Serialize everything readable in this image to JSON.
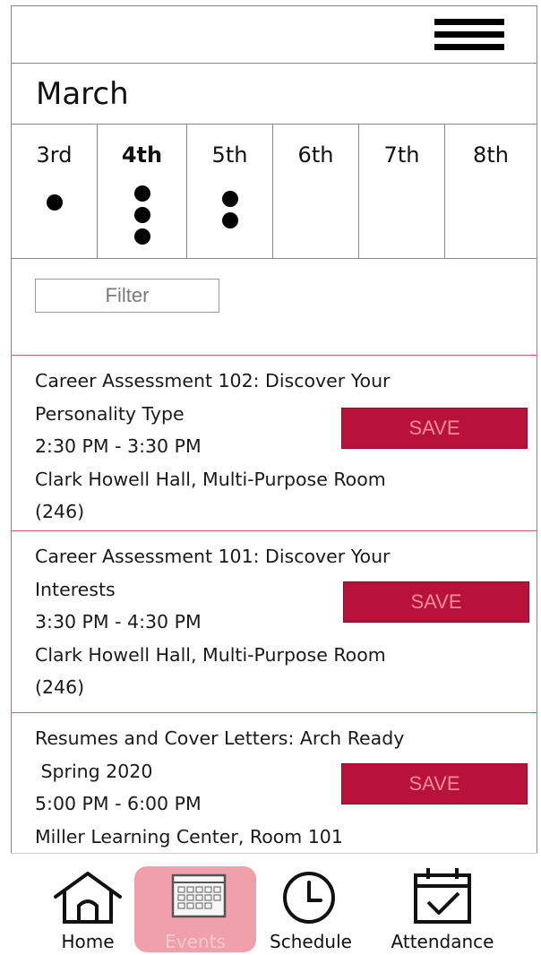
{
  "header": {
    "menu_icon": "hamburger-menu-icon"
  },
  "calendar": {
    "month": "March",
    "days": [
      {
        "label": "3rd",
        "dots": 1,
        "active": false
      },
      {
        "label": "4th",
        "dots": 3,
        "active": true
      },
      {
        "label": "5th",
        "dots": 2,
        "active": false
      },
      {
        "label": "6th",
        "dots": 0,
        "active": false
      },
      {
        "label": "7th",
        "dots": 0,
        "active": false
      },
      {
        "label": "8th",
        "dots": 0,
        "active": false
      }
    ]
  },
  "filter": {
    "placeholder": "Filter",
    "value": ""
  },
  "events": [
    {
      "lines": [
        "Career Assessment 102: Discover Your",
        "Personality Type",
        "2:30 PM - 3:30 PM",
        "Clark Howell Hall, Multi-Purpose Room",
        "(246)"
      ],
      "save_label": "SAVE"
    },
    {
      "lines": [
        "Career Assessment 101: Discover Your",
        "Interests",
        "3:30 PM - 4:30 PM",
        "Clark Howell Hall, Multi-Purpose Room",
        "(246)"
      ],
      "save_label": "SAVE"
    },
    {
      "lines": [
        "Resumes and Cover Letters: Arch Ready",
        " Spring 2020",
        "5:00 PM - 6:00 PM",
        "Miller Learning Center, Room 101"
      ],
      "save_label": "SAVE"
    }
  ],
  "nav": {
    "items": [
      {
        "label": "Home",
        "icon": "home-icon",
        "active": false
      },
      {
        "label": "Events",
        "icon": "calendar-grid-icon",
        "active": true
      },
      {
        "label": "Schedule",
        "icon": "clock-icon",
        "active": false
      },
      {
        "label": "Attendance",
        "icon": "calendar-check-icon",
        "active": false
      }
    ]
  },
  "colors": {
    "accent": "#b8123a",
    "divider": "#d95b6a",
    "active_nav": "#f0a0ab"
  }
}
